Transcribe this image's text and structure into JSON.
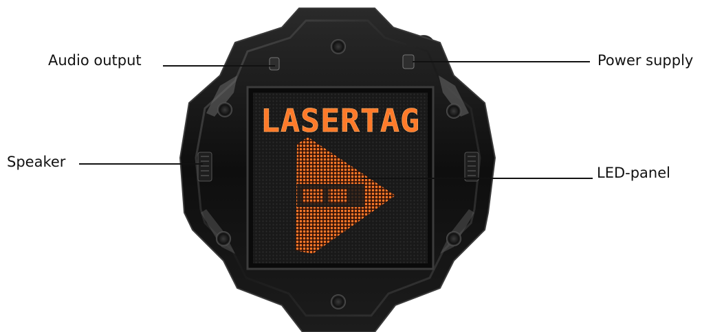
{
  "labels": {
    "audio_output": "Audio output",
    "power_supply": "Power supply",
    "speaker": "Speaker",
    "led_panel": "LED-panel"
  },
  "led_display": {
    "text": "LASERTAG",
    "color": "#ff7a2a"
  },
  "colors": {
    "housing": "#121212",
    "panel": "#1b1b1b",
    "led": "#ff7a2a",
    "label_text": "#111111"
  }
}
